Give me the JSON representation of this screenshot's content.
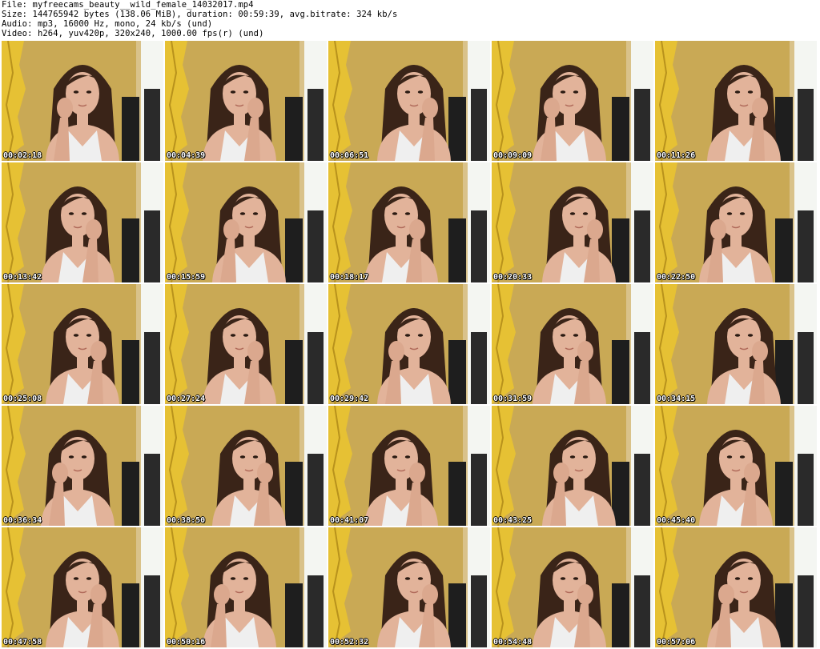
{
  "header": {
    "file": "File: myfreecams_beauty__wild_female_14032017.mp4",
    "size": "Size: 144765942 bytes (138.06 MiB), duration: 00:59:39, avg.bitrate: 324 kb/s",
    "audio": "Audio: mp3, 16000 Hz, mono, 24 kb/s (und)",
    "video": "Video: h264, yuv420p, 320x240, 1000.00 fps(r) (und)"
  },
  "thumbnails": [
    {
      "timestamp": "00:02:18"
    },
    {
      "timestamp": "00:04:39"
    },
    {
      "timestamp": "00:06:51"
    },
    {
      "timestamp": "00:09:09"
    },
    {
      "timestamp": "00:11:26"
    },
    {
      "timestamp": "00:13:42"
    },
    {
      "timestamp": "00:15:59"
    },
    {
      "timestamp": "00:18:17"
    },
    {
      "timestamp": "00:20:33"
    },
    {
      "timestamp": "00:22:50"
    },
    {
      "timestamp": "00:25:08"
    },
    {
      "timestamp": "00:27:24"
    },
    {
      "timestamp": "00:29:42"
    },
    {
      "timestamp": "00:31:59"
    },
    {
      "timestamp": "00:34:15"
    },
    {
      "timestamp": "00:36:34"
    },
    {
      "timestamp": "00:38:50"
    },
    {
      "timestamp": "00:41:07"
    },
    {
      "timestamp": "00:43:25"
    },
    {
      "timestamp": "00:45:40"
    },
    {
      "timestamp": "00:47:58"
    },
    {
      "timestamp": "00:50:16"
    },
    {
      "timestamp": "00:52:32"
    },
    {
      "timestamp": "00:54:48"
    },
    {
      "timestamp": "00:57:06"
    }
  ],
  "colors": {
    "background": "#ffffff",
    "wall": "#c9a955",
    "curtain": "#e8c233",
    "hair": "#3a2418",
    "skin": "#e2b39a",
    "top": "#efefef",
    "chair": "#1e1e1e",
    "window": "#f4f6f2"
  }
}
